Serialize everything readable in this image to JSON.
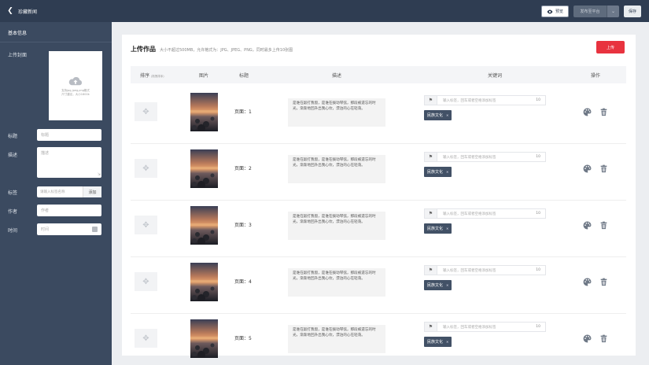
{
  "topbar": {
    "title": "珍藏新闻",
    "preview_label": "预览",
    "publish_label": "发布至平台",
    "save_label": "保存"
  },
  "sidebar": {
    "heading": "基本信息",
    "cover_label": "上传封面",
    "cover_hint_line1": "支持jpg,jpeg,png格式",
    "cover_hint_line2": "尺寸建议，大小1600k",
    "title_label": "标题",
    "title_placeholder": "标题",
    "desc_label": "描述",
    "desc_placeholder": "描述",
    "tag_label": "标签",
    "tag_placeholder": "请输入标签名称",
    "tag_add": "添加",
    "author_label": "作者",
    "author_placeholder": "作者",
    "time_label": "时间",
    "time_placeholder": "时间"
  },
  "main": {
    "title": "上传作品",
    "desc": "大小不超过500MB，允许格式为：JPG、JPEG、PNG，同时最多上传10张图",
    "upload_label": "上传",
    "columns": {
      "sort": "排序",
      "sort_hint": "(拖拽排序)",
      "image": "图片",
      "title": "标题",
      "desc": "描述",
      "keyword": "关键词",
      "action": "操作"
    },
    "rows": [
      {
        "title": "页面：1",
        "desc": "是谁在敲打我窗，是谁在拨动琴弦，那段被遗忘的时光，渐渐地回升出我心坎，漂泊的心在轻荡。",
        "kw_placeholder": "输入标签，回车或者空格添加标签",
        "kw_count": "10",
        "chip": "民族文化"
      },
      {
        "title": "页面：2",
        "desc": "是谁在敲打我窗，是谁在拨动琴弦，那段被遗忘的时光，渐渐地回升出我心坎，漂泊的心在轻荡。",
        "kw_placeholder": "输入标签，回车或者空格添加标签",
        "kw_count": "10",
        "chip": "民族文化"
      },
      {
        "title": "页面：3",
        "desc": "是谁在敲打我窗，是谁在拨动琴弦，那段被遗忘的时光，渐渐地回升出我心坎，漂泊的心在轻荡。",
        "kw_placeholder": "输入标签，回车或者空格添加标签",
        "kw_count": "10",
        "chip": "民族文化"
      },
      {
        "title": "页面：4",
        "desc": "是谁在敲打我窗，是谁在拨动琴弦，那段被遗忘的时光，渐渐地回升出我心坎，漂泊的心在轻荡。",
        "kw_placeholder": "输入标签，回车或者空格添加标签",
        "kw_count": "10",
        "chip": "民族文化"
      },
      {
        "title": "页面：5",
        "desc": "是谁在敲打我窗，是谁在拨动琴弦，那段被遗忘的时光，渐渐地回升出我心坎，漂泊的心在轻荡。",
        "kw_placeholder": "输入标签，回车或者空格添加标签",
        "kw_count": "10",
        "chip": "民族文化"
      }
    ]
  },
  "colors": {
    "topbar": "#2f3d52",
    "sidebar": "#3b4a60",
    "accent_red": "#e8333f",
    "chip": "#425166"
  },
  "icons": {
    "back": "chevron-left-icon",
    "preview": "eye-icon",
    "dropdown": "chevron-down-icon",
    "upload": "cloud-upload-icon",
    "drag": "move-icon",
    "tag": "tag-icon",
    "palette": "palette-icon",
    "trash": "trash-icon",
    "calendar": "calendar-icon"
  }
}
